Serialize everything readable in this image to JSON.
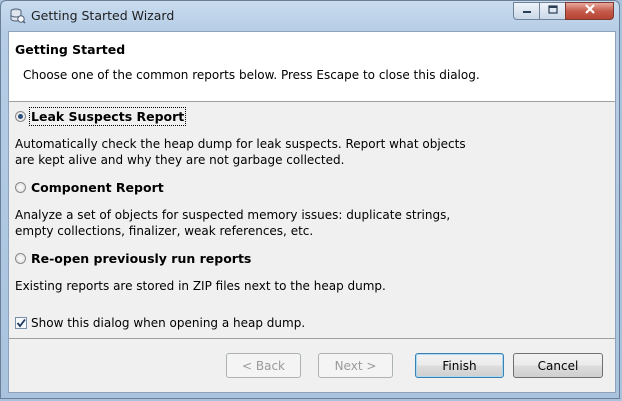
{
  "window": {
    "title": "Getting Started Wizard"
  },
  "header": {
    "title": "Getting Started",
    "description": "Choose one of the common reports below. Press Escape to close this dialog."
  },
  "options": [
    {
      "label": "Leak Suspects Report",
      "checked": true,
      "description_line1": "Automatically check the heap dump for leak suspects. Report what objects",
      "description_line2": "are kept alive and why they are not garbage collected."
    },
    {
      "label": "Component Report",
      "checked": false,
      "description_line1": "Analyze a set of objects for suspected memory issues: duplicate strings,",
      "description_line2": "empty collections, finalizer, weak references, etc."
    },
    {
      "label": "Re-open previously run reports",
      "checked": false,
      "description_line1": "Existing reports are stored in ZIP files next to the heap dump."
    }
  ],
  "show_dialog_checkbox": {
    "label": "Show this dialog when opening a heap dump.",
    "checked": true
  },
  "buttons": {
    "back": {
      "label": "< Back",
      "enabled": false
    },
    "next": {
      "label": "Next >",
      "enabled": false
    },
    "finish": {
      "label": "Finish",
      "enabled": true
    },
    "cancel": {
      "label": "Cancel",
      "enabled": true
    }
  }
}
